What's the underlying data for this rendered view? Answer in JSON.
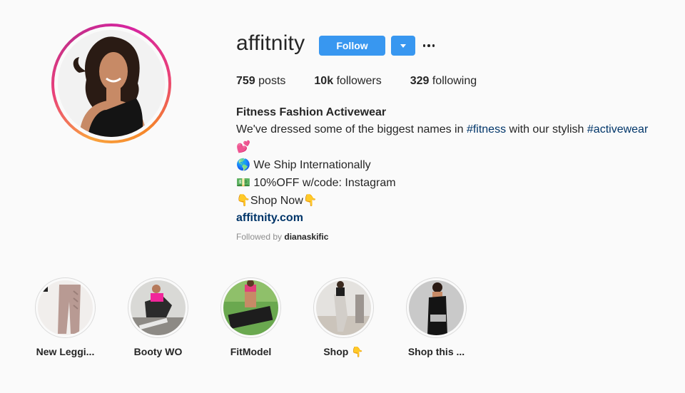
{
  "profile": {
    "username": "affitnity",
    "follow_label": "Follow",
    "stats": {
      "posts_count": "759",
      "posts_label": "posts",
      "followers_count": "10k",
      "followers_label": "followers",
      "following_count": "329",
      "following_label": "following"
    },
    "bio": {
      "name": "Fitness Fashion Activewear",
      "line1_text": "We've dressed some of the biggest names in ",
      "hashtag1": "#fitness",
      "line1_mid": " with our stylish ",
      "hashtag2": "#activewear",
      "line2_emoji": "💕",
      "line3_emoji": "🌎",
      "line3_text": "We Ship Internationally",
      "line4_emoji": "💵",
      "line4_text": "10%OFF w/code: Instagram",
      "line5_emoji_left": "👇",
      "line5_text": "Shop Now",
      "line5_emoji_right": "👇",
      "link": "affitnity.com"
    },
    "followed_by_label": "Followed by",
    "followed_by_user": "dianaskific"
  },
  "highlights": [
    {
      "label": "New Leggi..."
    },
    {
      "label": "Booty WO"
    },
    {
      "label": "FitModel"
    },
    {
      "label": "Shop 👇"
    },
    {
      "label": "Shop this ..."
    }
  ],
  "colors": {
    "follow_blue": "#3897f0",
    "hashtag_blue": "#003569",
    "text_dark": "#262626",
    "text_muted": "#8e8e8e",
    "background": "#fafafa"
  }
}
